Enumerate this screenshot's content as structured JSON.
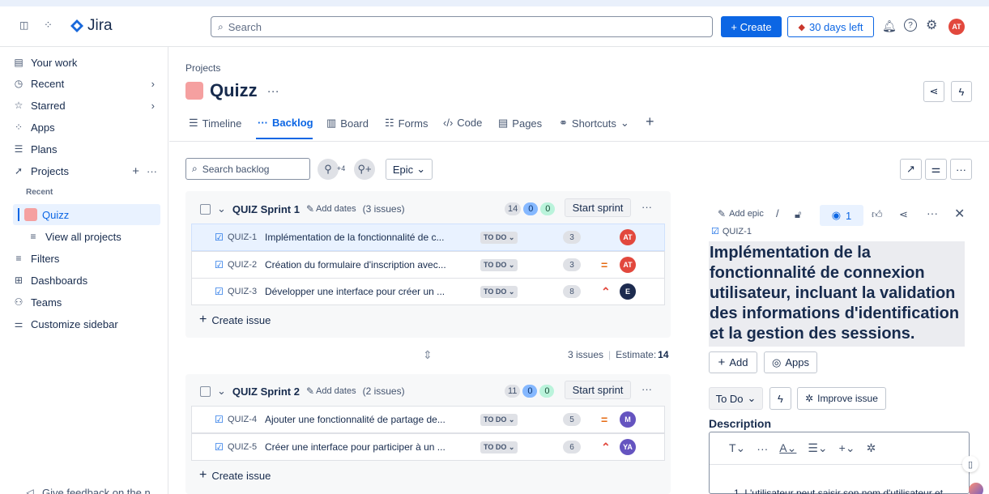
{
  "topbar": {
    "app_name": "Jira",
    "search_placeholder": "Search",
    "create_label": "+ Create",
    "trial_label": "30 days left",
    "avatar_initials": "AT"
  },
  "sidebar": {
    "items": [
      {
        "label": "Your work",
        "icon": "inbox-icon"
      },
      {
        "label": "Recent",
        "icon": "clock-icon"
      },
      {
        "label": "Starred",
        "icon": "star-icon"
      },
      {
        "label": "Apps",
        "icon": "apps-icon"
      },
      {
        "label": "Plans",
        "icon": "plans-icon"
      },
      {
        "label": "Projects",
        "icon": "rocket-icon"
      }
    ],
    "recent_heading": "Recent",
    "recent_project": "Quizz",
    "view_all": "View all projects",
    "items2": [
      {
        "label": "Filters"
      },
      {
        "label": "Dashboards"
      },
      {
        "label": "Teams"
      },
      {
        "label": "Customize sidebar"
      }
    ],
    "feedback": "Give feedback on the n..."
  },
  "header": {
    "breadcrumb": "Projects",
    "title": "Quizz"
  },
  "tabs": [
    {
      "label": "Timeline"
    },
    {
      "label": "Backlog"
    },
    {
      "label": "Board"
    },
    {
      "label": "Forms"
    },
    {
      "label": "Code"
    },
    {
      "label": "Pages"
    },
    {
      "label": "Shortcuts"
    }
  ],
  "backlog": {
    "search_placeholder": "Search backlog",
    "avatar_more": "+4",
    "epic_filter": "Epic"
  },
  "sprints": [
    {
      "name": "QUIZ Sprint 1",
      "add_dates": "Add dates",
      "issue_count": "(3 issues)",
      "counts": [
        "14",
        "0",
        "0"
      ],
      "start": "Start sprint",
      "footer_issues": "3 issues",
      "footer_estimate_label": "Estimate:",
      "footer_estimate": "14",
      "issues": [
        {
          "key": "QUIZ-1",
          "summary": "Implémentation de la fonctionnalité de c...",
          "status": "TO DO",
          "estimate": "3",
          "priority": "",
          "assignee": "AT",
          "color": "#e2483d"
        },
        {
          "key": "QUIZ-2",
          "summary": "Création du formulaire d'inscription avec...",
          "status": "TO DO",
          "estimate": "3",
          "priority": "=",
          "assignee": "AT",
          "color": "#e2483d"
        },
        {
          "key": "QUIZ-3",
          "summary": "Développer une interface pour créer un ...",
          "status": "TO DO",
          "estimate": "8",
          "priority": "^",
          "assignee": "E",
          "color": "#1d2b4f"
        }
      ]
    },
    {
      "name": "QUIZ Sprint 2",
      "add_dates": "Add dates",
      "issue_count": "(2 issues)",
      "counts": [
        "11",
        "0",
        "0"
      ],
      "start": "Start sprint",
      "issues": [
        {
          "key": "QUIZ-4",
          "summary": "Ajouter une fonctionnalité de partage de...",
          "status": "TO DO",
          "estimate": "5",
          "priority": "=",
          "assignee": "M",
          "color": "#6554c0"
        },
        {
          "key": "QUIZ-5",
          "summary": "Créer une interface pour participer à un ...",
          "status": "TO DO",
          "estimate": "6",
          "priority": "^",
          "assignee": "YA",
          "color": "#6554c0"
        }
      ]
    }
  ],
  "create_issue": "Create issue",
  "detail": {
    "add_epic": "Add epic",
    "watch_count": "1",
    "key": "QUIZ-1",
    "title": "Implémentation de la fonctionnalité de connexion utilisateur, incluant la validation des informations d'identification et la gestion des sessions.",
    "add": "Add",
    "apps": "Apps",
    "status": "To Do",
    "improve": "Improve issue",
    "description_label": "Description",
    "description_text": "1. L'utilisateur peut saisir son nom d'utilisateur et"
  }
}
